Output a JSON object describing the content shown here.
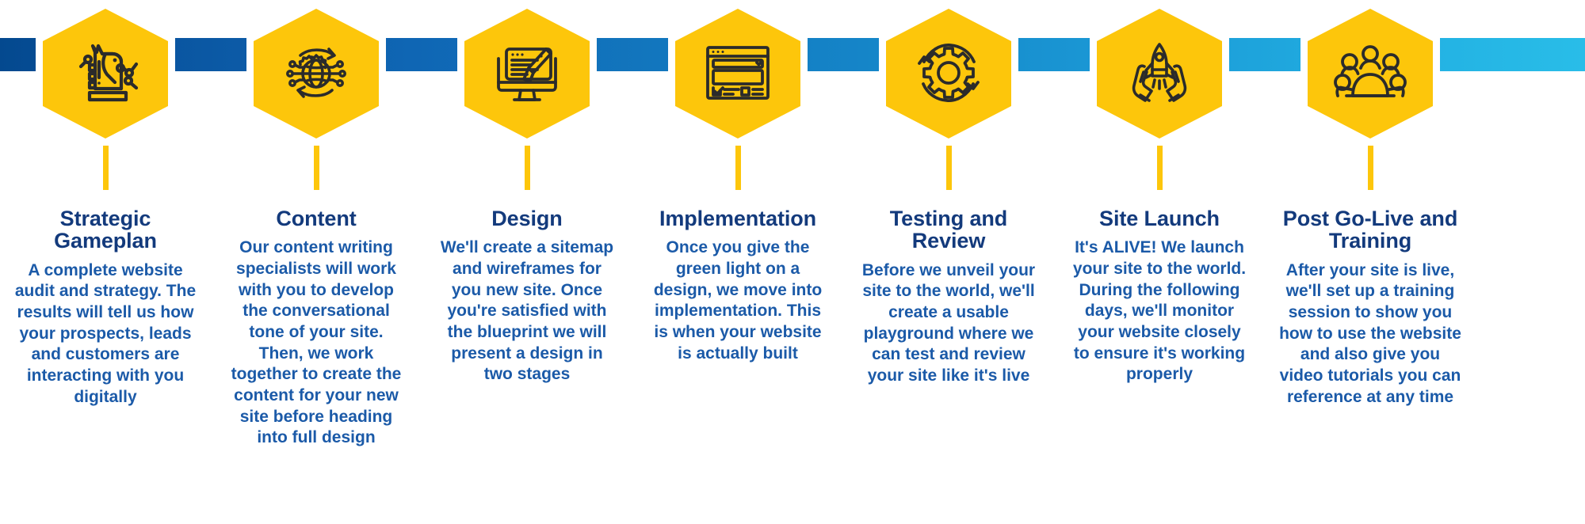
{
  "theme": {
    "hex_fill": "#fdc60b",
    "hex_border": "#ffffff",
    "icon_stroke": "#2b2b2b",
    "title_color": "#133a7c",
    "body_color": "#1b5aa8",
    "ribbon_start": "#04498f",
    "ribbon_end": "#29bde8",
    "background": "#ffffff"
  },
  "steps": [
    {
      "icon": "chess-knight-strategy-icon",
      "title": "Strategic Gameplan",
      "description": "A complete website audit and strategy. The results will tell us how your prospects, leads and customers are interacting with you digitally"
    },
    {
      "icon": "globe-gear-network-icon",
      "title": "Content",
      "description": "Our content writing specialists will work with you to develop the conversational tone of your site. Then, we work together to create the content for your new site before heading into full design"
    },
    {
      "icon": "monitor-pen-design-icon",
      "title": "Design",
      "description": "We'll create a sitemap and wireframes for you new site. Once you're satisfied with the blueprint we will present a design in two stages"
    },
    {
      "icon": "browser-wireframe-icon",
      "title": "Implementation",
      "description": "Once you give the green light on a design, we move into implementation. This is when your website is actually built"
    },
    {
      "icon": "gear-cycle-icon",
      "title": "Testing and Review",
      "description": "Before we unveil your site to the world, we'll create a usable playground where we can test and review your site like it's live"
    },
    {
      "icon": "rocket-hands-launch-icon",
      "title": "Site Launch",
      "description": "It's ALIVE! We launch your site to the world. During the following days, we'll monitor your website closely to ensure it's working properly"
    },
    {
      "icon": "people-group-training-icon",
      "title": "Post Go-Live and Training",
      "description": "After your site is live, we'll set up a training session to show you how to use the website and also give you video tutorials you can reference at any time"
    }
  ]
}
